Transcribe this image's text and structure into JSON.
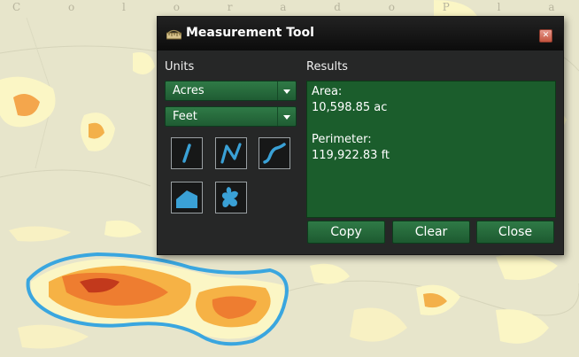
{
  "map": {
    "watermark": "C o l o r a d o   P l a t e a u"
  },
  "dialog": {
    "title": "Measurement Tool",
    "units_label": "Units",
    "area_unit": "Acres",
    "length_unit": "Feet",
    "results_label": "Results",
    "tools": [
      {
        "icon": "line-tool-icon"
      },
      {
        "icon": "polyline-tool-icon"
      },
      {
        "icon": "freehand-line-tool-icon"
      },
      {
        "icon": "polygon-tool-icon"
      },
      {
        "icon": "freehand-polygon-tool-icon"
      }
    ],
    "results": {
      "area_label": "Area:",
      "area_value": "10,598.85 ac",
      "perimeter_label": "Perimeter:",
      "perimeter_value": "119,922.83 ft"
    },
    "buttons": {
      "copy": "Copy",
      "clear": "Clear",
      "close": "Close"
    },
    "colors": {
      "accent_green": "#1f5c33",
      "results_green": "#1b5d2c",
      "tool_blue": "#3aa1d6",
      "panel_bg": "#262727",
      "outline_blue": "#3aa6df"
    }
  }
}
